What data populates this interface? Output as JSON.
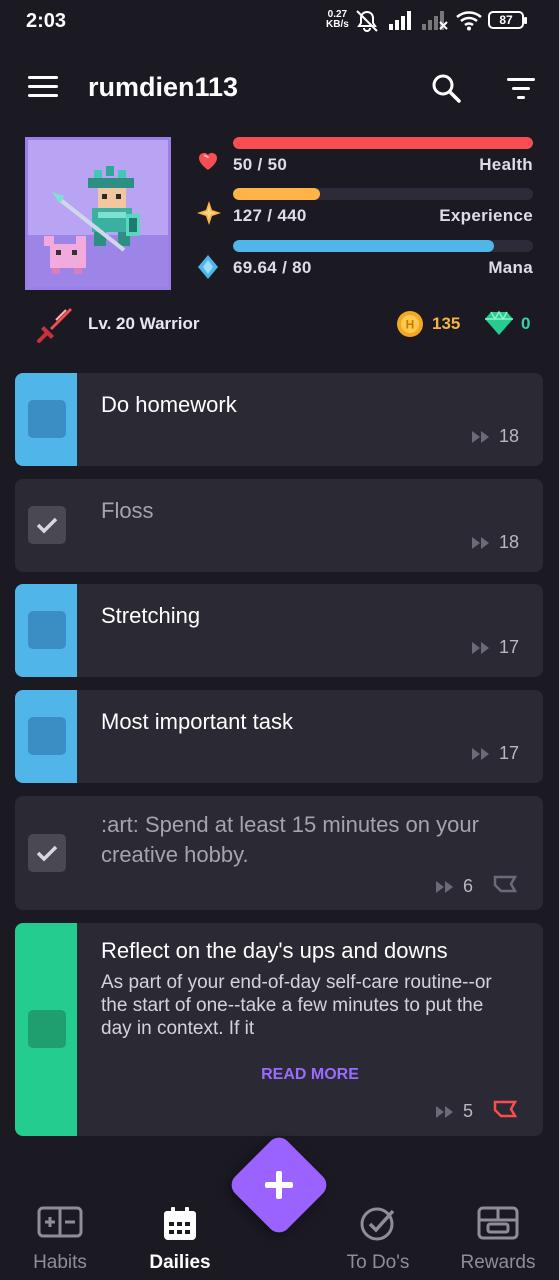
{
  "status_bar": {
    "time": "2:03",
    "net_speed_value": "0.27",
    "net_speed_unit": "KB/s",
    "battery": "87",
    "icons": [
      "mute-icon",
      "signal-icon",
      "signal-off-icon",
      "wifi-icon",
      "battery-icon"
    ]
  },
  "toolbar": {
    "username": "rumdien113",
    "icons": [
      "menu-icon",
      "search-icon",
      "filter-icon"
    ]
  },
  "stats": {
    "health": {
      "value": "50 / 50",
      "label": "Health",
      "fraction": 1.0,
      "color": "#f74e52",
      "icon": "heart-icon"
    },
    "experience": {
      "value": "127 / 440",
      "label": "Experience",
      "fraction": 0.2886,
      "color": "#ffb445",
      "icon": "star-icon"
    },
    "mana": {
      "value": "69.64 / 80",
      "label": "Mana",
      "fraction": 0.8705,
      "color": "#50b5e9",
      "icon": "mana-drop-icon"
    }
  },
  "player": {
    "level_text": "Lv. 20 Warrior",
    "gold": "135",
    "gems": "0",
    "icons": [
      "sword-icon",
      "gold-coin-icon",
      "gem-icon"
    ]
  },
  "tasks": [
    {
      "title": "Do homework",
      "streak": "18",
      "done": false,
      "color": "#50b5e9"
    },
    {
      "title": "Floss",
      "streak": "18",
      "done": true,
      "color": "#2b2933"
    },
    {
      "title": "Stretching",
      "streak": "17",
      "done": false,
      "color": "#50b5e9"
    },
    {
      "title": "Most important task",
      "streak": "17",
      "done": false,
      "color": "#50b5e9"
    },
    {
      "title": ":art: Spend at least 15 minutes on your creative hobby.",
      "streak": "6",
      "done": true,
      "color": "#2b2933"
    },
    {
      "title": "Reflect on the day's ups and downs",
      "notes": "As part of your end-of-day self-care routine--or the start of one--take a few minutes to put the day in context. If it",
      "read_more": "READ MORE",
      "streak": "5",
      "done": false,
      "color": "#24cc8f"
    }
  ],
  "bottom_nav": {
    "items": [
      {
        "label": "Habits",
        "icon": "habits-icon",
        "active": false
      },
      {
        "label": "Dailies",
        "icon": "calendar-icon",
        "active": true
      },
      {
        "label": "To Do's",
        "icon": "check-circle-icon",
        "active": false
      },
      {
        "label": "Rewards",
        "icon": "rewards-icon",
        "active": false
      }
    ],
    "fab_icon": "plus-icon"
  },
  "colors": {
    "background": "#1b1922",
    "card": "#2b2933",
    "accent": "#9a62ff"
  }
}
